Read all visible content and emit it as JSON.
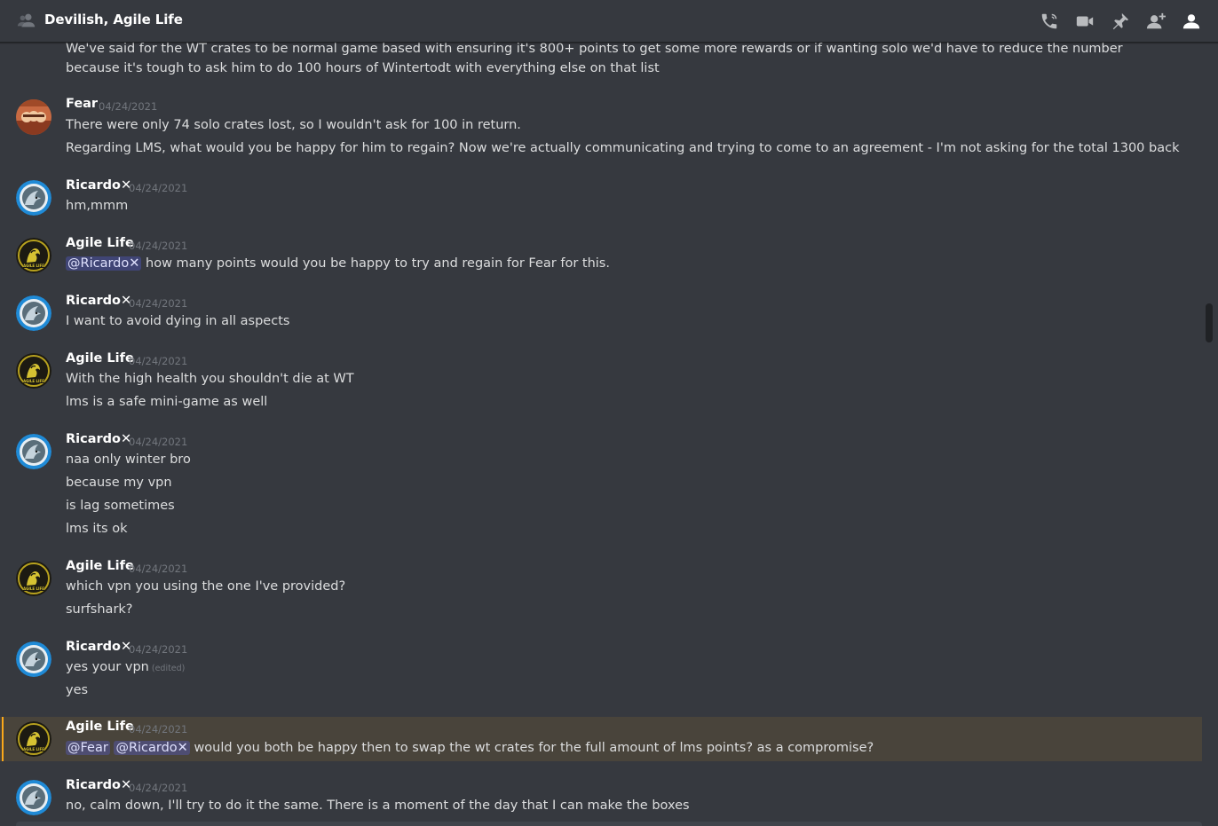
{
  "header": {
    "title": "Devilish, Agile Life",
    "icons": [
      "start-voice-call-icon",
      "start-video-call-icon",
      "pinned-messages-icon",
      "add-friends-to-dm-icon",
      "member-list-icon"
    ]
  },
  "colors": {
    "background": "#36393f",
    "header_border": "#202225",
    "timestamp": "#72767d",
    "mention_bg": "#5865f24d",
    "highlight_bar": "#faa81a"
  },
  "messages": {
    "m0": {
      "text": "We've said for the WT crates to be normal game based with ensuring it's 800+ points to get some more rewards or if wanting solo we'd have to reduce the number because it's tough to ask him to do 100 hours of Wintertodt with everything else on that list"
    },
    "m1": {
      "author": "Fear",
      "timestamp": "04/24/2021",
      "lines": [
        "There were only 74 solo crates lost, so I wouldn't ask for 100 in return.",
        "Regarding LMS, what would you be happy for him to regain? Now we're actually communicating and trying to come to an agreement - I'm not asking for the total 1300 back"
      ]
    },
    "m2": {
      "author": "Ricardo✕",
      "timestamp": "04/24/2021",
      "lines": [
        "hm,mmm"
      ]
    },
    "m3": {
      "author": "Agile Life",
      "timestamp": "04/24/2021",
      "mention": "@Ricardo✕",
      "text": " how many points would you be happy to try and regain for Fear for this."
    },
    "m4": {
      "author": "Ricardo✕",
      "timestamp": "04/24/2021",
      "lines": [
        "I want to avoid dying in all aspects"
      ]
    },
    "m5": {
      "author": "Agile Life",
      "timestamp": "04/24/2021",
      "lines": [
        "With the high health you shouldn't die at WT",
        "lms is a safe mini-game as well"
      ]
    },
    "m6": {
      "author": "Ricardo✕",
      "timestamp": "04/24/2021",
      "lines": [
        "naa only winter bro",
        "because my vpn",
        "is lag sometimes",
        "lms its ok"
      ]
    },
    "m7": {
      "author": "Agile Life",
      "timestamp": "04/24/2021",
      "lines": [
        "which vpn you using the one I've provided?",
        "surfshark?"
      ]
    },
    "m8": {
      "author": "Ricardo✕",
      "timestamp": "04/24/2021",
      "lines": [
        "yes your vpn",
        "yes"
      ],
      "edited": "(edited)"
    },
    "m9": {
      "author": "Agile Life",
      "timestamp": "04/24/2021",
      "mention1": "@Fear",
      "mention2": "@Ricardo✕",
      "text": " would you both be happy then to swap the wt crates for the full amount of lms points? as a compromise?"
    },
    "m10": {
      "author": "Ricardo✕",
      "timestamp": "04/24/2021",
      "lines": [
        "no, calm down, I'll try to do it the same. There is a moment of the day that I can make the boxes"
      ]
    }
  },
  "avatars": {
    "fear": "fear-avatar",
    "ricardo": "ricardo-shark-avatar",
    "agile": "agile-life-avatar"
  }
}
